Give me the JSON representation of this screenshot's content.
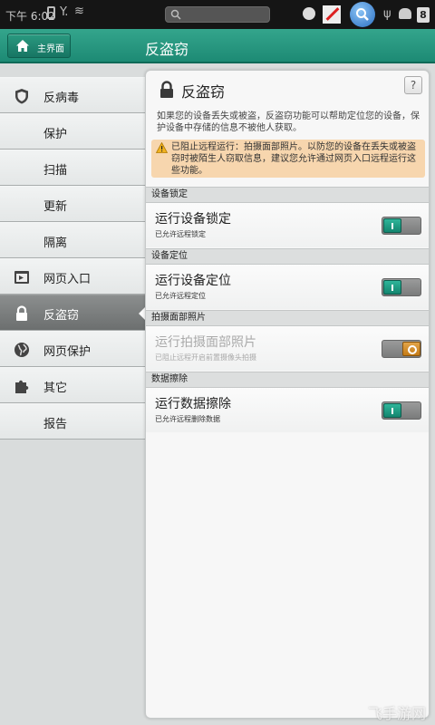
{
  "status_bar": {
    "time": "下午 6:02",
    "battery": "8"
  },
  "header": {
    "home_label": "主界面",
    "title": "反盗窃"
  },
  "sidebar": {
    "items": [
      {
        "label": "反病毒"
      },
      {
        "label": "保护"
      },
      {
        "label": "扫描"
      },
      {
        "label": "更新"
      },
      {
        "label": "隔离"
      },
      {
        "label": "网页入口"
      },
      {
        "label": "反盗窃"
      },
      {
        "label": "网页保护"
      },
      {
        "label": "其它"
      },
      {
        "label": "报告"
      }
    ],
    "active": "反盗窃"
  },
  "panel": {
    "title": "反盗窃",
    "help": "?",
    "description": "如果您的设备丢失或被盗，反盗窃功能可以帮助定位您的设备，保护设备中存储的信息不被他人获取。",
    "warning": "已阻止远程运行：拍摄面部照片。以防您的设备在丢失或被盗窃时被陌生人窃取信息，建议您允许通过网页入口远程运行这些功能。",
    "sections": [
      {
        "header": "设备锁定",
        "title": "运行设备锁定",
        "subtitle": "已允许远程锁定",
        "toggle": "on",
        "enabled": true
      },
      {
        "header": "设备定位",
        "title": "运行设备定位",
        "subtitle": "已允许远程定位",
        "toggle": "on",
        "enabled": true
      },
      {
        "header": "拍摄面部照片",
        "title": "运行拍摄面部照片",
        "subtitle": "已阻止远程开启前置摄像头拍摄",
        "toggle": "blocked",
        "enabled": false
      },
      {
        "header": "数据擦除",
        "title": "运行数据擦除",
        "subtitle": "已允许远程删除数据",
        "toggle": "on",
        "enabled": true
      }
    ]
  },
  "watermark": "飞手游网",
  "colors": {
    "accent": "#1d8a74",
    "warning_bg": "#f7d6ae",
    "toggle_on": "#13866f",
    "toggle_blocked": "#c47b16"
  }
}
